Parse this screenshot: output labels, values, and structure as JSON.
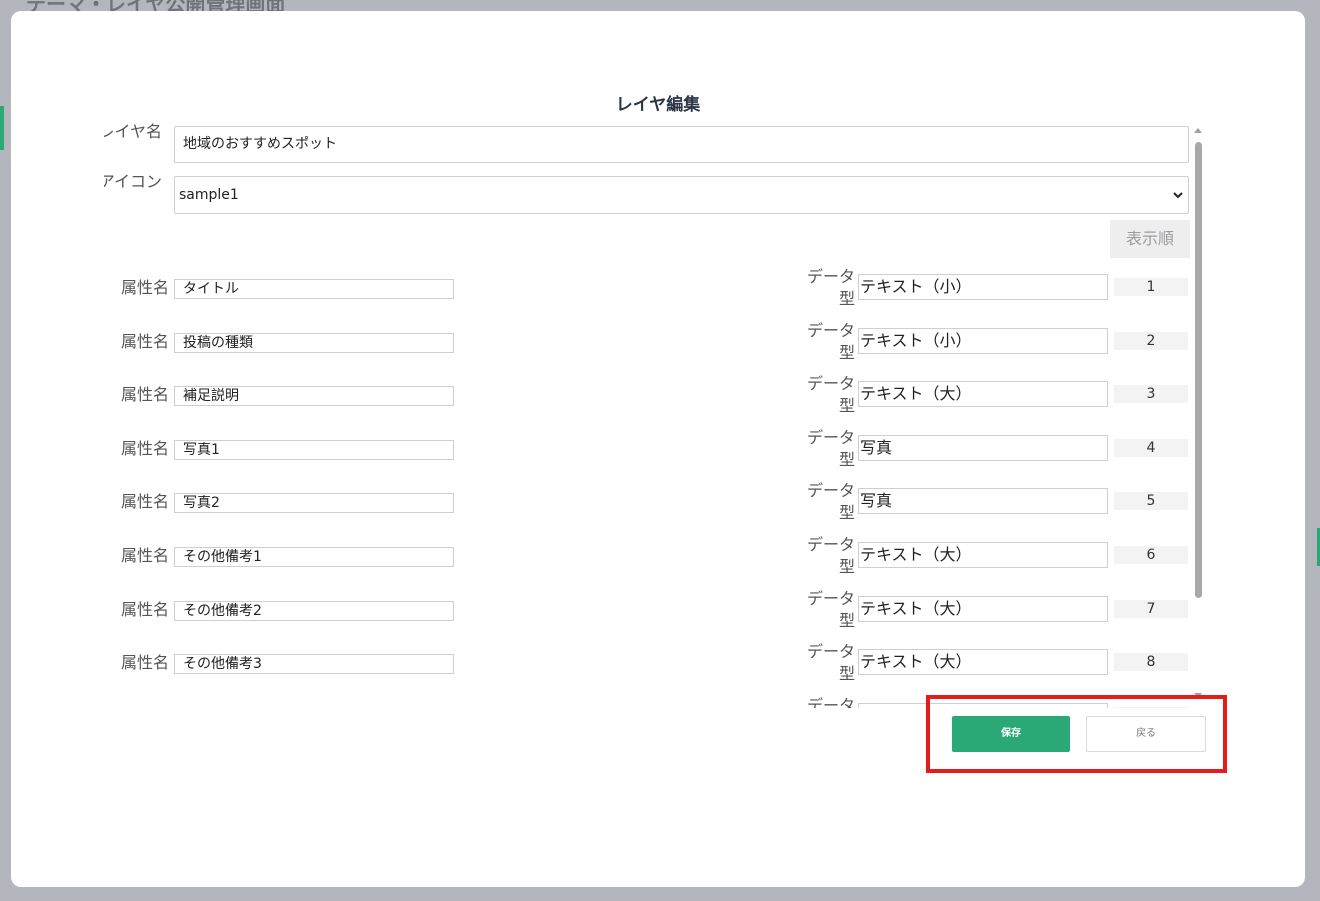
{
  "background": {
    "title": "テーマ・レイヤ公開管理画面"
  },
  "modal": {
    "title": "レイヤ編集"
  },
  "layer_name": {
    "label": "レイヤ名",
    "value": "地域のおすすめスポット"
  },
  "icon": {
    "label": "アイコン",
    "selected": "sample1"
  },
  "order_header": "表示順",
  "attribute_label": "属性名",
  "data_type_label": "データ型",
  "attributes": [
    {
      "name": "タイトル",
      "type": "テキスト（小）",
      "order": "1"
    },
    {
      "name": "投稿の種類",
      "type": "テキスト（小）",
      "order": "2"
    },
    {
      "name": "補足説明",
      "type": "テキスト（大）",
      "order": "3"
    },
    {
      "name": "写真1",
      "type": "写真",
      "order": "4"
    },
    {
      "name": "写真2",
      "type": "写真",
      "order": "5"
    },
    {
      "name": "その他備考1",
      "type": "テキスト（大）",
      "order": "6"
    },
    {
      "name": "その他備考2",
      "type": "テキスト（大）",
      "order": "7"
    },
    {
      "name": "その他備考3",
      "type": "テキスト（大）",
      "order": "8"
    },
    {
      "name": "",
      "type": "",
      "order": ""
    }
  ],
  "buttons": {
    "save": "保存",
    "back": "戻る"
  },
  "colors": {
    "accent": "#2aa876",
    "highlight": "#e51c1c",
    "overlay": "#b3b7bd"
  }
}
